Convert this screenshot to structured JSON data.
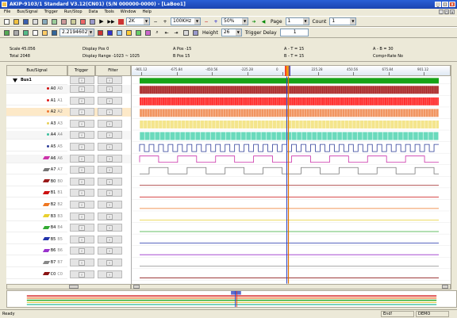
{
  "window": {
    "title": "AKIP-9103/1 Standard V3.12(CN01) (S/N 000000-0000) - [LaBoo1]"
  },
  "menu": [
    "File",
    "Bus/Signal",
    "Trigger",
    "Run/Stop",
    "Data",
    "Tools",
    "Window",
    "Help"
  ],
  "toolbar1": {
    "freq_select": "2K",
    "rate_select": "100KHz",
    "percent_select": "50%",
    "page_label": "Page",
    "page_value": "1",
    "count_label": "Count",
    "count_value": "1"
  },
  "toolbar2": {
    "voltage_select": "2.2194602V",
    "height_label": "Height",
    "height_value": "26",
    "trigger_delay_label": "Trigger Delay",
    "trigger_delay_value": "1"
  },
  "info": {
    "scale": "Scale 45.056",
    "total": "Total 2048",
    "display_pos": "Display Pos 0",
    "display_range": "Display Range -1023 ~ 1025",
    "a_pos": "A Pos -15",
    "b_pos": "B Pos 15",
    "a_t": "A - T = 15",
    "b_t": "B - T = 15",
    "a_b": "A - B = 30",
    "compr": "Compr-Rate No"
  },
  "headers": {
    "bus": "Bus/Signal",
    "trigger": "Trigger",
    "filter": "Filter"
  },
  "ruler_ticks": [
    "-901.12",
    "-675.84",
    "-450.56",
    "-225.28",
    "0",
    "225.28",
    "450.56",
    "675.84",
    "901.12",
    "1126"
  ],
  "bus": {
    "name": "Bus1"
  },
  "signals": [
    {
      "name": "A0",
      "sub": "A0",
      "color": "#d01010",
      "kind": "dot"
    },
    {
      "name": "A1",
      "sub": "A1",
      "color": "#e01818",
      "kind": "dot"
    },
    {
      "name": "A2",
      "sub": "A2",
      "color": "#ee7733",
      "kind": "dot"
    },
    {
      "name": "A3",
      "sub": "A3",
      "color": "#e8d05a",
      "kind": "dot"
    },
    {
      "name": "A4",
      "sub": "A4",
      "color": "#3bbf9e",
      "kind": "dot"
    },
    {
      "name": "A5",
      "sub": "A5",
      "color": "#2f3f99",
      "kind": "dot"
    },
    {
      "name": "A6",
      "sub": "A6",
      "color": "#cc33aa",
      "kind": "pen"
    },
    {
      "name": "A7",
      "sub": "A7",
      "color": "#777777",
      "kind": "pen"
    },
    {
      "name": "B0",
      "sub": "B0",
      "color": "#9a1a1a",
      "kind": "pen"
    },
    {
      "name": "B1",
      "sub": "B1",
      "color": "#cc1111",
      "kind": "pen"
    },
    {
      "name": "B2",
      "sub": "B2",
      "color": "#ee7722",
      "kind": "pen"
    },
    {
      "name": "B3",
      "sub": "B3",
      "color": "#e8d030",
      "kind": "pen"
    },
    {
      "name": "B4",
      "sub": "B4",
      "color": "#33aa33",
      "kind": "pen"
    },
    {
      "name": "B5",
      "sub": "B5",
      "color": "#2233aa",
      "kind": "pen"
    },
    {
      "name": "B6",
      "sub": "B6",
      "color": "#9933cc",
      "kind": "pen"
    },
    {
      "name": "B7",
      "sub": "B7",
      "color": "#888888",
      "kind": "pen"
    },
    {
      "name": "C0",
      "sub": "C0",
      "color": "#8a1414",
      "kind": "pen"
    }
  ],
  "status": {
    "left": "Ready",
    "right1": "End!",
    "right2": "DEMO"
  }
}
